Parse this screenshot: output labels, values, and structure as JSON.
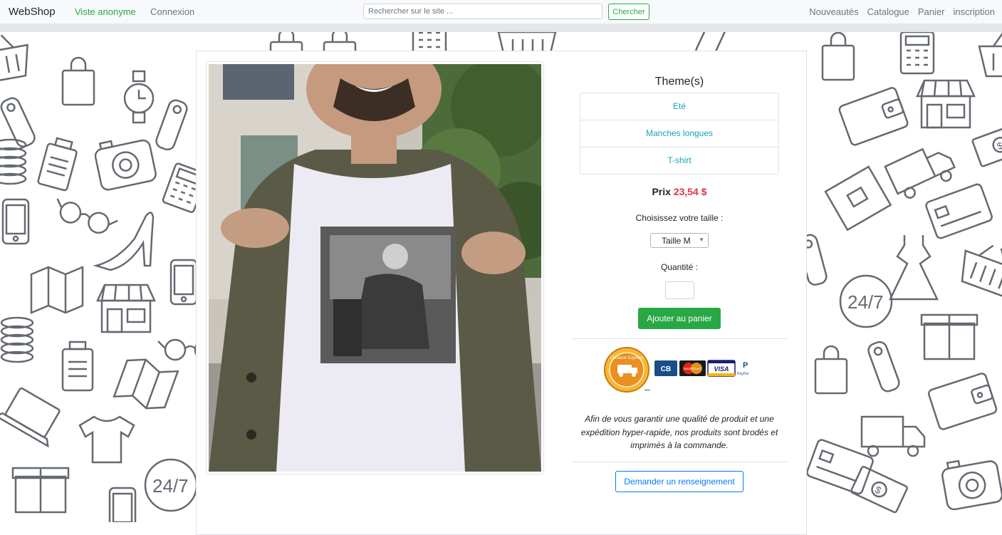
{
  "navbar": {
    "brand": "WebShop",
    "anonymous_label": "Viste anonyme",
    "login_label": "Connexion",
    "search_placeholder": "Rechercher sur le site ...",
    "search_button": "Chercher",
    "links": {
      "new": "Nouveautés",
      "catalog": "Catalogue",
      "cart": "Panier",
      "signup": "inscription"
    }
  },
  "product": {
    "themes_title": "Theme(s)",
    "themes": [
      "Eté",
      "Manches longues",
      "T-shirt"
    ],
    "price_label": "Prix",
    "price_value": "23,54 $",
    "size_label": "Choisissez votre taille :",
    "size_selected": "Taille M",
    "quantity_label": "Quantité :",
    "quantity_value": "",
    "add_to_cart": "Ajouter au panier",
    "info_text": "Afin de vous garantir une qualité de produit et une expédition hyper-rapide, nos produits sont brodés et imprimés à la commande.",
    "ask_button": "Demander un renseignement"
  },
  "payment_badges": {
    "seal_text": "Livraison Express",
    "cards": [
      "CB",
      "MasterCard",
      "VISA",
      "PayPal"
    ]
  },
  "colors": {
    "success": "#28a745",
    "info": "#17a2b8",
    "price": "#dc3545",
    "primary": "#007bff"
  }
}
